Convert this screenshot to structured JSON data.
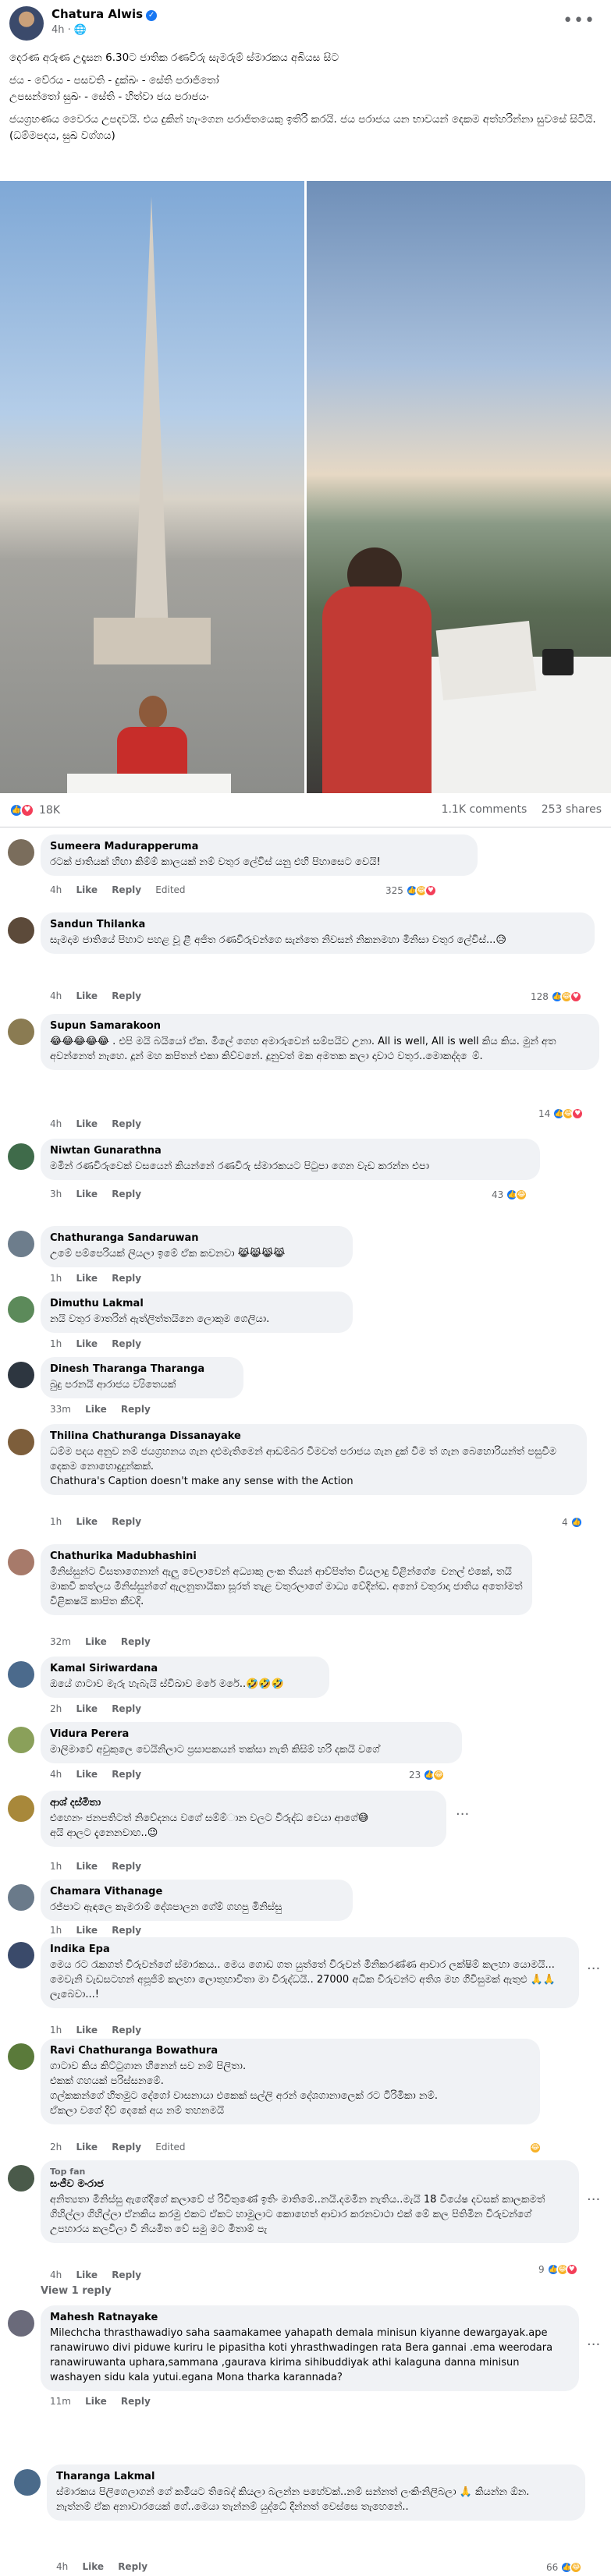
{
  "post": {
    "author": "Chatura Alwis",
    "time": "4h",
    "privacy_icon": "globe-icon",
    "paragraphs": [
      "දෙරණ අරුණ උදෑසන 6.30ට ජාතික රණවිරු සැමරුම් ස්මාරකය අබියස සිට",
      "ජය - වේරය - පසවති - දුක්ඛං - සේති පරාජිතෝ",
      "උපසන්තෝ සුඛං - සේති - හිත්වා ජය පරාජයං",
      "ජයග්‍රහණය වෛරය උපදවයි. එය දුකින් හැංගෙන පරාජිතයෙකු ඉතිරි කරයි. ජය පරාජය යන භාවයන් දෙකම අත්හරින්නා සුවසේ සිටියි.",
      "(ධම්මපදය, සුඛ වග්ගය)"
    ]
  },
  "stats": {
    "reaction_count": "18K",
    "comments": "1.1K comments",
    "shares": "253 shares"
  },
  "comments": [
    {
      "name": "Sumeera Madurapperuma",
      "text": "රටක් ජාතියක් හිඟා කිම්ම් කාලයක් නම් වතුර ලේවිස් යනු එහි පිහාසෙට වෙයි!",
      "time": "4h",
      "edited": "Edited",
      "reacts": "325"
    },
    {
      "name": "Sandun Thilanka",
      "text": "සැමදාම ජාතියේ පිහාට පහළ වූ ළී අජිත රණවිරුවන්ගෙ සැන්තෙ නිවසන් නිකනමහා මිනිසා වතුර ලේවිස්...😥",
      "time": "4h",
      "edited": "",
      "reacts": "128"
    },
    {
      "name": "Supun Samarakoon",
      "text": "😂😂😂😂😂 . එපි මයි බයියෝ ඒක. මිලේ ගෙහ අමාරුවෙන් සම්පයිව උනා. All is well, All is well කිය කිය. මුන් අත අවන්නෙත් නැහෙ. දූන් මහ කපිතන් එකා කිව්වනේ. දූනුවත් මක අමතක කලා දාවාථ වතුර..මොකද්ද ෙම්.",
      "time": "4h",
      "edited": "",
      "reacts": "14"
    },
    {
      "name": "Niwtan Gunarathna",
      "text": "මමින් රණවිරුවෙක් වසයෙන් කියන්නේ රණවිරු ස්මාරකයට පිටුපා ගෙන වැඩ කරන්න එපා",
      "time": "3h",
      "edited": "",
      "reacts": "43"
    },
    {
      "name": "Chathuranga Sandaruwan",
      "text": "උමේ පම්පෙරියක් ලියලා ඉමේ ඒක කවනවා 😹😹😹😹",
      "time": "1h",
      "edited": "",
      "reacts": ""
    },
    {
      "name": "Dimuthu Lakmal",
      "text": "නයි වතුර මාතරින් ඇත්ලිත්තයිනෙ ලොකුම ගෙලියා.",
      "time": "1h",
      "edited": "",
      "reacts": ""
    },
    {
      "name": "Dinesh Tharanga Tharanga",
      "text": "බුදු පරනයි ආරාජය ව්‍යිතෙයක්",
      "time": "33m",
      "edited": "",
      "reacts": ""
    },
    {
      "name": "Thilina Chathuranga Dissanayake",
      "text": "ධම්ම පදය අනුව නම් ජයග්‍රහනය ගැන දළුමැතිමෙන් ආඩම්බර වීමවත් පරාජය ගැන දුක් වීම ත් ගැන බෙහොරියන්ත් පසුවීම දෙකම නොහොදුදුන්කක්.\nChathura's Caption doesn't make any sense with the Action",
      "time": "1h",
      "edited": "",
      "reacts": "4"
    },
    {
      "name": "Chathurika Madubhashini",
      "text": "මිනිස්සුන්ට විසතාගෙනාන් ඇලු වෙලාවෙන් අධ්‍යාකු ලංක තියන් ආව්පිත්ත වියලාදු විළින්ගේ ෙචනල් එකේ, තයි මාකවී කත්ලය මිනිස්සුන්ගේ ඇලනුතායිකා සූරත් තැළ වතුරලාගේ මාධ්‍ය වේදින්ඩ. අනෝ වතුරාදා ජාතිය අතෝමත් විළිකෂයි කාපිත කීවදි.",
      "time": "32m",
      "edited": "",
      "reacts": ""
    },
    {
      "name": "Kamal Siriwardana",
      "text": "ඔයේ ගාටාව මැරු හැබැයි ස්විඛාව මරේ මරේ..🤣🤣🤣",
      "time": "2h",
      "edited": "",
      "reacts": ""
    },
    {
      "name": "Vidura Perera",
      "text": "මාලිමාවේ අවුකුලෙ වෙයිනිලාට ප්‍රසාපකයන් තක්සා නැති කිසිම් හරි දකයි වගේ",
      "time": "4h",
      "edited": "",
      "reacts": "23"
    },
    {
      "name": "ආශ් දස්මිතා",
      "text": "එහෙනං ජනපතිටත් නිවේදනය වගේ සම්ම්ාන වලට වීරුද්ධ වෙයා ආගේ😅\nඅයි ආලට දැනෙනවාහ..😉",
      "time": "1h",
      "edited": "",
      "reacts": ""
    },
    {
      "name": "Chamara Vithanage",
      "text": "රජ්පාට ඇඳලෙ කැමරාම් දේශපාලන ගේම් ගහපු මිනිස්සු",
      "time": "1h",
      "edited": "",
      "reacts": ""
    },
    {
      "name": "Indika Epa",
      "text": "මෙය රට රැකගත් විරුවන්ගේ ස්මාරකය.. මෙය ගොඩ ගත යුත්තේ විරුවන් මිනිකරණ්ණ ආවාර ලක්ෂිම් කලහා යොමයි... මෙවැනි වැඩසටහන් අපූජිම් කලහා ලොතුහාවිතා මා විරුද්ධයි.. 27000 අධික විරුවන්ට අතිශ මහ ගිවිසුමක් ඇතුළු 🙏🙏 ලැබෙවා...!",
      "time": "1h",
      "edited": "",
      "reacts": ""
    },
    {
      "name": "Ravi Chathuranga Bowathura",
      "text": "ගාටාව කිය කිට්ටුගාන හීනෙන් සව නම් පිලිතා.\nඑකක් ගහයක් පරිස්සනමේ.\nගල්කකන්ගේ හිතමුට දේගෝ වාසනායා එකෙක් සල්ලි අරන් දේශගානාලෙක් රට ටිරිමිකා නම්.\nඒකලා වගේ දිව් දෙකේ අය නම් තහනමයි",
      "time": "2h",
      "edited": "Edited",
      "reacts": ""
    },
    {
      "name": "සංජීව මංරාජ",
      "badge": "Top fan",
      "text": "අනිත්‍යතා මිනිස්සු ඇගේදිගේ කලාවේ ප් රිවිතුණේ ඉතිං මාතිමේ..නයි.දමමින නැතිය..මැයි 18 වියේෂ දවසක් කාලකමත් ගිහිල්ලා ගිහිල්ලා ඒනකිය කරමු එකට ඒකට හාමුලාට කොහෙත් ආවාර කරනවාථා එක් මේ කල පිතිමින විරුවන්ගේ උපහාරය කලවිලා වී නියමිත වේ සමු මට මීතාම් පැ",
      "time": "4h",
      "edited": "",
      "reacts": "9"
    },
    {
      "name": "Mahesh Ratnayake",
      "text": "Milechcha thrasthawadiyo saha saamakamee yahapath demala minisun kiyanne dewargayak.ape ranawiruwo divi piduwe kuriru le pipasitha koti yhrasthwadingen rata Bera gannai .ema weerodara ranawiruwanta uphara,sammana ,gaurava kirima sihibuddiyak athi kalaguna danna minisun washayen sidu kala yutui.egana Mona tharka karannada?",
      "time": "11m",
      "edited": "",
      "reacts": ""
    },
    {
      "name": "Tharanga Lakmal",
      "text": "ස්මාරකය පිලිගෙලාගන් ගේ කමියට තිබෙද් කියලා බලන්න පහේවක්..නම් සන්නත් ලංකිංනිලිබලා 🙏 කියන්න ඕන.\nනැත්නම් ඒක අනාවාරයෙක් ගේ..මෙයා තැන්නම් යුද්ධේ දින්නත් වෙස්සෙ තැහෙනේ..",
      "time": "4h",
      "edited": "",
      "reacts": "66"
    }
  ],
  "labels": {
    "like": "Like",
    "reply": "Reply",
    "view_reply": "View 1 reply"
  },
  "colors": {
    "accent": "#1877f2",
    "bubble": "#f0f2f5",
    "meta": "#65676b"
  }
}
